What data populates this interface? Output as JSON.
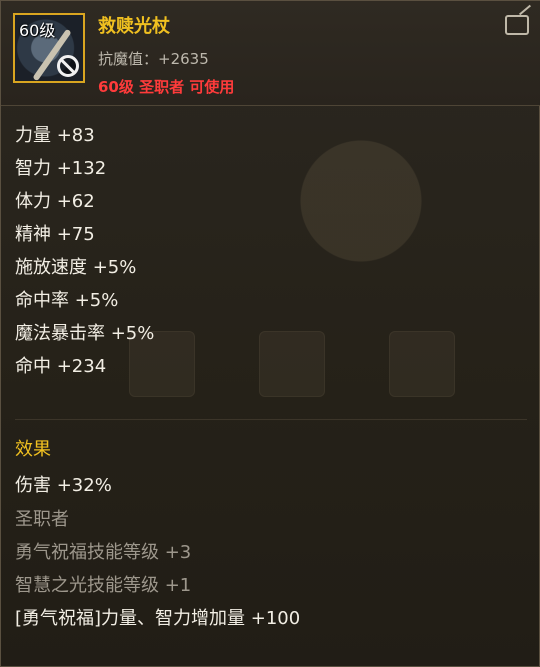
{
  "item": {
    "level_badge": "60级",
    "name": "救赎光杖",
    "main_stat": "抗魔值：+2635",
    "requirement": "60级 圣职者 可使用"
  },
  "stats": [
    "力量 +83",
    "智力 +132",
    "体力 +62",
    "精神 +75",
    "施放速度 +5%",
    "命中率 +5%",
    "魔法暴击率 +5%",
    "命中 +234"
  ],
  "effects": {
    "title": "效果",
    "lines": [
      "伤害 +32%",
      "圣职者",
      "勇气祝福技能等级 +3",
      "智慧之光技能等级 +1",
      "[勇气祝福]力量、智力增加量 +100"
    ]
  },
  "icons": {
    "item_icon": "staff-icon",
    "ban_icon": "prohibited-icon",
    "share_icon": "share-icon"
  },
  "colors": {
    "name": "#f0c020",
    "requirement": "#ff3b3b",
    "section": "#f0c020"
  }
}
